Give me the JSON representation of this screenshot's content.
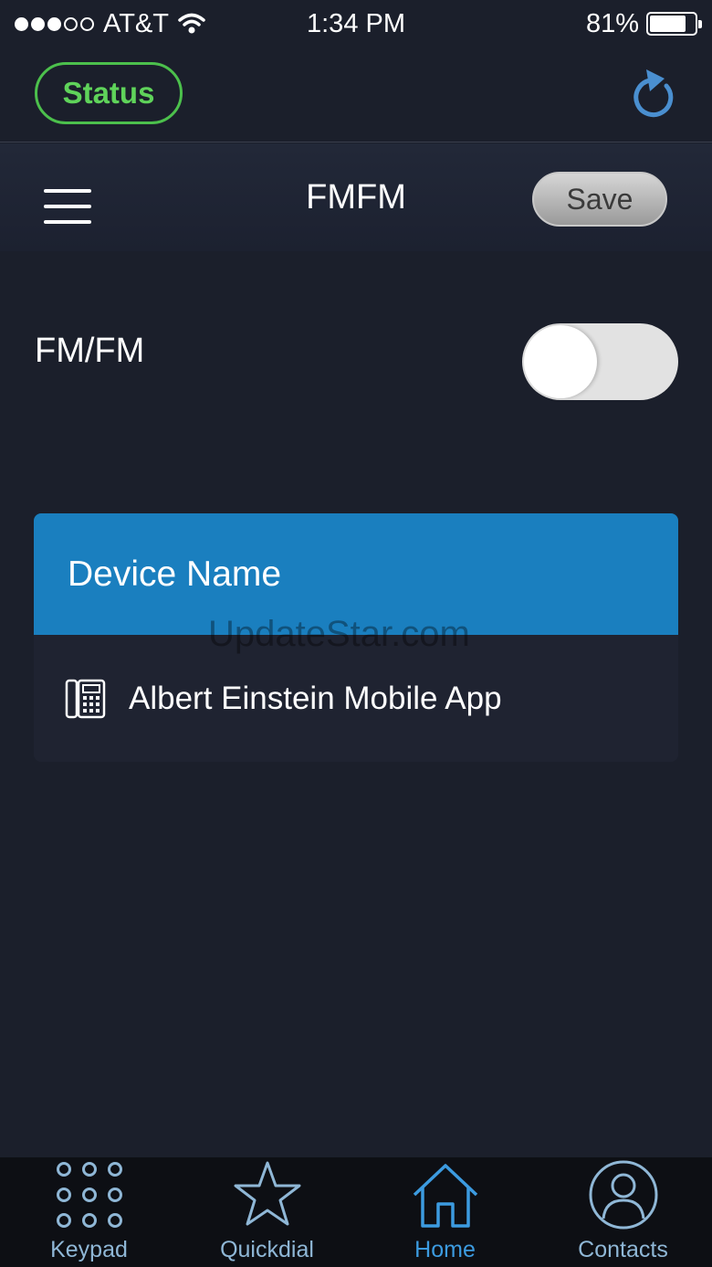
{
  "status_bar": {
    "carrier": "AT&T",
    "time": "1:34 PM",
    "battery_percent": "81%",
    "battery_level": 0.81,
    "signal_strength": 3
  },
  "appbar": {
    "status_label": "Status",
    "status_color": "#5fd35a",
    "refresh_icon": "refresh-icon"
  },
  "header": {
    "title": "FMFM",
    "save_label": "Save",
    "menu_icon": "hamburger-menu-icon"
  },
  "settings": {
    "toggle_label": "FM/FM",
    "toggle_on": false
  },
  "devices": {
    "header": "Device Name",
    "header_color": "#1a7fbf",
    "items": [
      {
        "name": "Albert Einstein Mobile App",
        "icon": "desk-phone-icon"
      }
    ]
  },
  "watermark": "UpdateStar.com",
  "nav": {
    "items": [
      {
        "label": "Keypad",
        "icon": "keypad-icon"
      },
      {
        "label": "Quickdial",
        "icon": "star-icon"
      },
      {
        "label": "Home",
        "icon": "home-icon",
        "active": true
      },
      {
        "label": "Contacts",
        "icon": "contacts-icon"
      }
    ]
  }
}
